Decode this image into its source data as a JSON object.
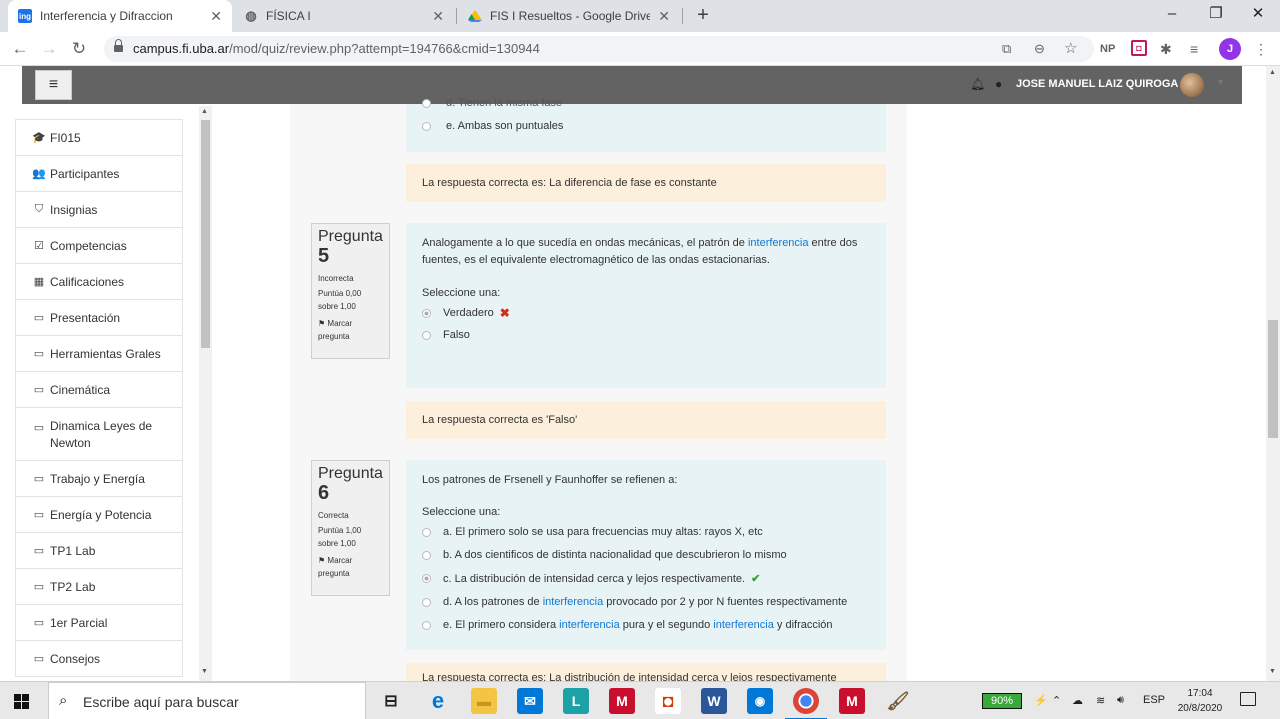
{
  "browser": {
    "tabs": [
      {
        "title": "Interferencia y Difraccion",
        "favicon": "ing",
        "favicon_color": "#1a73e8"
      },
      {
        "title": "FÍSICA I",
        "favicon": "globe",
        "favicon_color": "#5f6368"
      },
      {
        "title": "FIS I Resueltos - Google Drive",
        "favicon": "drive",
        "favicon_color": "#fbbc04"
      }
    ],
    "url_host": "campus.fi.uba.ar",
    "url_path": "/mod/quiz/review.php?attempt=194766&cmid=130944",
    "profile_initial": "J",
    "ext_np": "NP"
  },
  "navbar": {
    "user_name": "JOSE MANUEL LAIZ QUIROGA"
  },
  "drawer": {
    "items": [
      {
        "label": "FI015",
        "icon": "graduation-cap-icon",
        "glyph": "🎓"
      },
      {
        "label": "Participantes",
        "icon": "users-icon",
        "glyph": "👥"
      },
      {
        "label": "Insignias",
        "icon": "shield-icon",
        "glyph": "⛉"
      },
      {
        "label": "Competencias",
        "icon": "checkbox-icon",
        "glyph": "☑"
      },
      {
        "label": "Calificaciones",
        "icon": "table-icon",
        "glyph": "▦"
      },
      {
        "label": "Presentación",
        "icon": "folder-icon",
        "glyph": "▭"
      },
      {
        "label": "Herramientas Grales",
        "icon": "folder-icon",
        "glyph": "▭"
      },
      {
        "label": "Cinemática",
        "icon": "folder-icon",
        "glyph": "▭"
      },
      {
        "label": "Dinamica Leyes de Newton",
        "icon": "folder-icon",
        "glyph": "▭"
      },
      {
        "label": "Trabajo y Energía",
        "icon": "folder-icon",
        "glyph": "▭"
      },
      {
        "label": "Energía y Potencia",
        "icon": "folder-icon",
        "glyph": "▭"
      },
      {
        "label": "TP1 Lab",
        "icon": "folder-icon",
        "glyph": "▭"
      },
      {
        "label": "TP2 Lab",
        "icon": "folder-icon",
        "glyph": "▭"
      },
      {
        "label": "1er Parcial",
        "icon": "folder-icon",
        "glyph": "▭"
      },
      {
        "label": "Consejos",
        "icon": "folder-icon",
        "glyph": "▭"
      }
    ]
  },
  "prev_question": {
    "partial_option": "d. Tienen la misma fase",
    "option_e": "e. Ambas son puntuales",
    "feedback": "La respuesta correcta es: La diferencia de fase es constante"
  },
  "q5": {
    "label": "Pregunta",
    "number": "5",
    "state": "Incorrecta",
    "grade_line1": "Puntúa 0,00",
    "grade_line2": "sobre 1,00",
    "flag_line1": "Marcar",
    "flag_line2": "pregunta",
    "text_before": "Analogamente a lo que sucedía en ondas mecánicas, el patrón de ",
    "text_keyword": "interferencia",
    "text_after": " entre dos fuentes, es el equivalente electromagnético de las ondas estacionarias.",
    "prompt": "Seleccione una:",
    "options": [
      "Verdadero",
      "Falso"
    ],
    "feedback": "La respuesta correcta es 'Falso'"
  },
  "q6": {
    "label": "Pregunta",
    "number": "6",
    "state": "Correcta",
    "grade_line1": "Puntúa 1,00",
    "grade_line2": "sobre 1,00",
    "flag_line1": "Marcar",
    "flag_line2": "pregunta",
    "text": "Los patrones de Frsenell y Faunhoffer se refienen a:",
    "prompt": "Seleccione una:",
    "opt_a": "a. El primero solo se usa para frecuencias muy altas: rayos X, etc",
    "opt_b": "b. A dos cientificos de distinta nacionalidad que descubrieron lo mismo",
    "opt_c": "c. La distribución de intensidad cerca y lejos respectivamente.",
    "opt_d_pre": "d. A los patrones de ",
    "opt_d_kw": "interferencia",
    "opt_d_post": " provocado por 2 y por N fuentes respectivamente",
    "opt_e_pre": "e. El primero considera ",
    "opt_e_kw1": "interferencia",
    "opt_e_mid": " pura y el segundo ",
    "opt_e_kw2": "interferencia",
    "opt_e_post": " y difracción",
    "feedback_partial": "La respuesta correcta es: La distribución de intensidad cerca y lejos respectivamente"
  },
  "taskbar": {
    "search_placeholder": "Escribe aquí para buscar",
    "battery": "90%",
    "lang": "ESP",
    "time": "17:04",
    "date": "20/8/2020"
  },
  "colors": {
    "navbar": "#636363",
    "question_bg": "#e7f3f5",
    "feedback_bg": "#fcefdc",
    "link": "#1177d1",
    "incorrect": "#ca3120",
    "correct": "#3d9e32"
  }
}
